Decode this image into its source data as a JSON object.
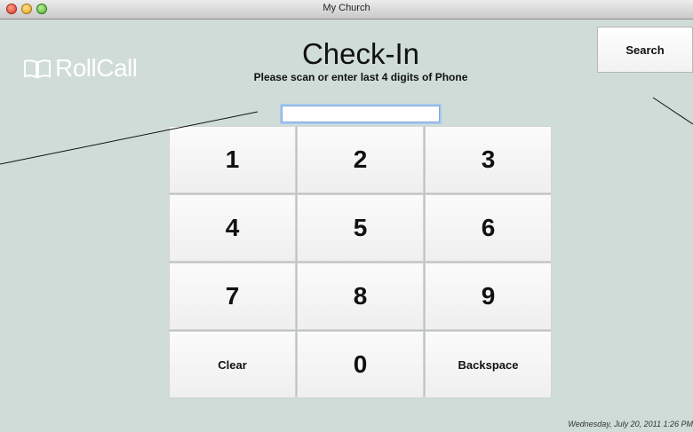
{
  "window": {
    "title": "My Church"
  },
  "brand": {
    "logo_text": "RollCall"
  },
  "header": {
    "title": "Check-In",
    "subtitle": "Please scan or enter last 4 digits of Phone"
  },
  "search_button": {
    "label": "Search"
  },
  "phone_input": {
    "value": ""
  },
  "keypad": {
    "keys": [
      "1",
      "2",
      "3",
      "4",
      "5",
      "6",
      "7",
      "8",
      "9",
      "Clear",
      "0",
      "Backspace"
    ]
  },
  "footer": {
    "datetime": "Wednesday, July 20, 2011 1:26 PM"
  },
  "colors": {
    "background": "#cfdcd8",
    "input_focus": "#a9c8ee"
  }
}
